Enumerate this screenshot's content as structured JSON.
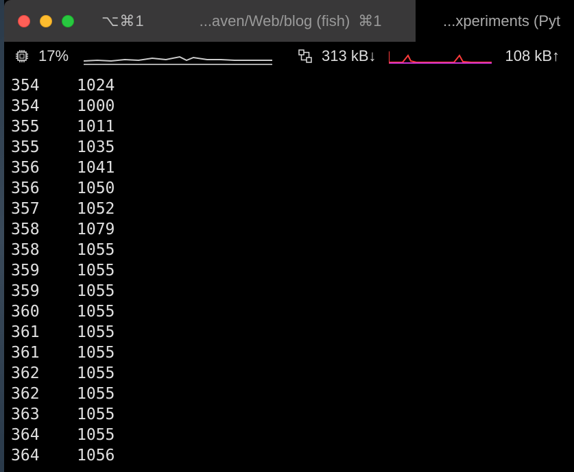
{
  "titlebar": {
    "shortcut_label": "⌥⌘1",
    "active_tab_title": "...aven/Web/blog (fish)",
    "active_tab_shortcut": "⌘1",
    "inactive_tab_title": "...xperiments (Pyt"
  },
  "statusbar": {
    "cpu_percent": "17%",
    "net_down": "313 kB↓",
    "net_up": "108 kB↑"
  },
  "terminal_rows": [
    {
      "c1": "354",
      "c2": "1024"
    },
    {
      "c1": "354",
      "c2": "1000"
    },
    {
      "c1": "355",
      "c2": "1011"
    },
    {
      "c1": "355",
      "c2": "1035"
    },
    {
      "c1": "356",
      "c2": "1041"
    },
    {
      "c1": "356",
      "c2": "1050"
    },
    {
      "c1": "357",
      "c2": "1052"
    },
    {
      "c1": "358",
      "c2": "1079"
    },
    {
      "c1": "358",
      "c2": "1055"
    },
    {
      "c1": "359",
      "c2": "1055"
    },
    {
      "c1": "359",
      "c2": "1055"
    },
    {
      "c1": "360",
      "c2": "1055"
    },
    {
      "c1": "361",
      "c2": "1055"
    },
    {
      "c1": "361",
      "c2": "1055"
    },
    {
      "c1": "362",
      "c2": "1055"
    },
    {
      "c1": "362",
      "c2": "1055"
    },
    {
      "c1": "363",
      "c2": "1055"
    },
    {
      "c1": "364",
      "c2": "1055"
    },
    {
      "c1": "364",
      "c2": "1056"
    }
  ]
}
